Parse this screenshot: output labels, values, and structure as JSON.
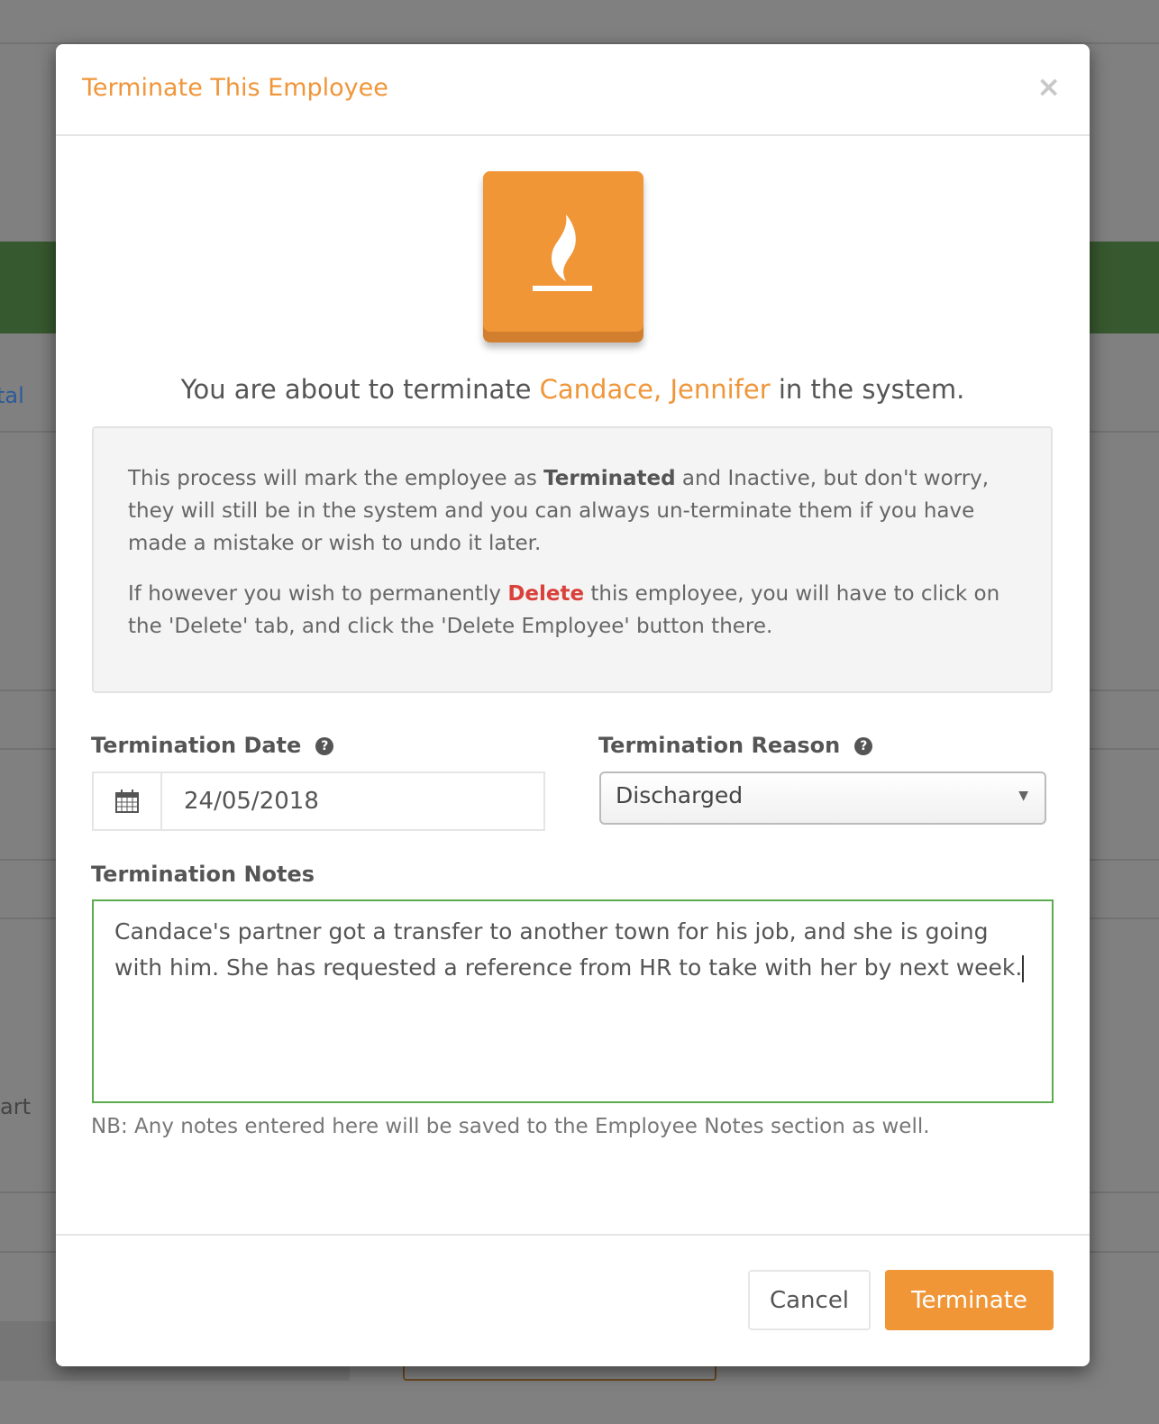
{
  "background": {
    "left_text_1": "tal",
    "left_text_2": "art"
  },
  "modal": {
    "title": "Terminate This Employee",
    "close_label": "×",
    "icon": "fire-icon",
    "heading_prefix": "You are about to terminate ",
    "employee_name": "Candace, Jennifer",
    "heading_suffix": " in the system.",
    "info": {
      "p1_a": "This process will mark the employee as ",
      "p1_bold": "Terminated",
      "p1_b": " and Inactive, but don't worry, they will still be in the system and you can always un-terminate them if you have made a mistake or wish to undo it later.",
      "p2_a": "If however you wish to permanently ",
      "p2_bold": "Delete",
      "p2_b": " this employee, you will have to click on the 'Delete' tab, and click the 'Delete Employee' button there."
    },
    "date_label": "Termination Date",
    "date_value": "24/05/2018",
    "reason_label": "Termination Reason",
    "reason_value": "Discharged",
    "help_icon": "?",
    "notes_label": "Termination Notes",
    "notes_value": "Candace's partner got a transfer to another town for his job, and she is going with him. She has requested a reference from HR to take with her by next week.",
    "nb": "NB: Any notes entered here will be saved to the Employee Notes section as well.",
    "cancel_label": "Cancel",
    "terminate_label": "Terminate"
  },
  "colors": {
    "accent": "#f09637",
    "danger": "#d9413a",
    "focus": "#5cab4c"
  }
}
